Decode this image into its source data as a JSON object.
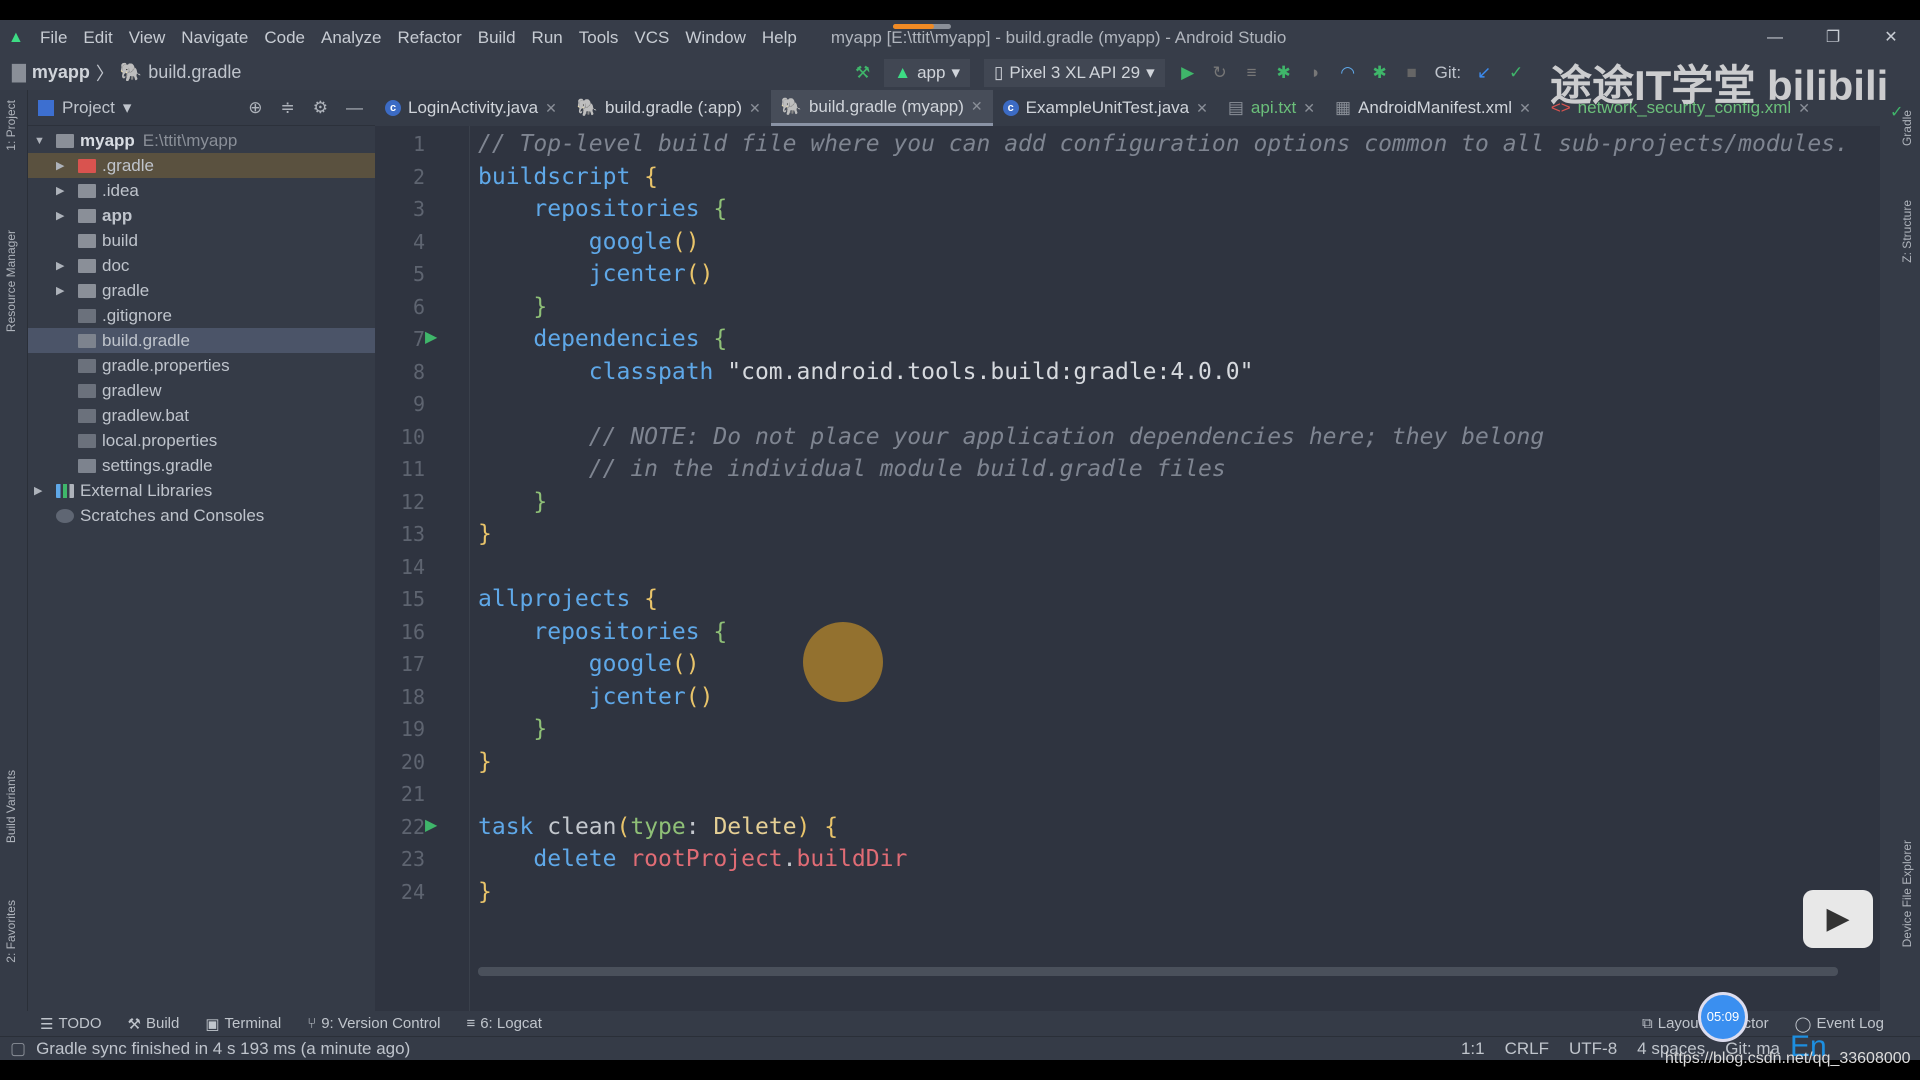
{
  "window": {
    "title": "myapp [E:\\ttit\\myapp] - build.gradle (myapp) - Android Studio",
    "load_progress": 0.7
  },
  "menu": [
    "File",
    "Edit",
    "View",
    "Navigate",
    "Code",
    "Analyze",
    "Refactor",
    "Build",
    "Run",
    "Tools",
    "VCS",
    "Window",
    "Help"
  ],
  "breadcrumb": {
    "project": "myapp",
    "file": "build.gradle"
  },
  "toolbar": {
    "config": "app",
    "device": "Pixel 3 XL API 29",
    "git_label": "Git:"
  },
  "left_strip": {
    "project": "1: Project",
    "resource": "Resource Manager",
    "variants": "Build Variants",
    "favorites": "2: Favorites"
  },
  "right_strip": {
    "gradle": "Gradle",
    "structure": "Z: Structure",
    "device": "Device File Explorer"
  },
  "project_panel": {
    "title": "Project",
    "root": {
      "name": "myapp",
      "path": "E:\\ttit\\myapp"
    },
    "items": [
      {
        "name": ".gradle",
        "type": "folder-excluded",
        "expandable": true
      },
      {
        "name": ".idea",
        "type": "folder",
        "expandable": true
      },
      {
        "name": "app",
        "type": "module",
        "expandable": true
      },
      {
        "name": "build",
        "type": "folder",
        "expandable": false
      },
      {
        "name": "doc",
        "type": "folder",
        "expandable": true
      },
      {
        "name": "gradle",
        "type": "folder",
        "expandable": true
      },
      {
        "name": ".gitignore",
        "type": "file",
        "expandable": false
      },
      {
        "name": "build.gradle",
        "type": "gradle",
        "expandable": false,
        "selected": true
      },
      {
        "name": "gradle.properties",
        "type": "properties",
        "expandable": false
      },
      {
        "name": "gradlew",
        "type": "script",
        "expandable": false
      },
      {
        "name": "gradlew.bat",
        "type": "file",
        "expandable": false
      },
      {
        "name": "local.properties",
        "type": "properties",
        "expandable": false
      },
      {
        "name": "settings.gradle",
        "type": "gradle",
        "expandable": false
      }
    ],
    "external": "External Libraries",
    "scratches": "Scratches and Consoles"
  },
  "tabs": [
    {
      "label": "LoginActivity.java",
      "icon": "C"
    },
    {
      "label": "build.gradle (:app)",
      "icon": "gradle"
    },
    {
      "label": "build.gradle (myapp)",
      "icon": "gradle",
      "active": true
    },
    {
      "label": "ExampleUnitTest.java",
      "icon": "C"
    },
    {
      "label": "api.txt",
      "icon": "text"
    },
    {
      "label": "AndroidManifest.xml",
      "icon": "MF"
    },
    {
      "label": "network_security_config.xml",
      "icon": "xml"
    }
  ],
  "code": [
    [
      [
        "// Top-level build file where you can add configuration options common to all sub-projects/modules.",
        "c"
      ]
    ],
    [
      [
        "buildscript ",
        "k"
      ],
      [
        "{",
        "b"
      ]
    ],
    [
      [
        "    repositories ",
        "k"
      ],
      [
        "{",
        "g"
      ]
    ],
    [
      [
        "        google",
        "k"
      ],
      [
        "()",
        "p"
      ]
    ],
    [
      [
        "        jcenter",
        "k"
      ],
      [
        "()",
        "p"
      ]
    ],
    [
      [
        "    }",
        "g"
      ]
    ],
    [
      [
        "    dependencies ",
        "k"
      ],
      [
        "{",
        "g"
      ]
    ],
    [
      [
        "        classpath ",
        "k"
      ],
      [
        "\"com.android.tools.build:gradle:4.0.0\"",
        "s"
      ]
    ],
    [
      [
        "",
        ""
      ]
    ],
    [
      [
        "        // NOTE: Do not place your application dependencies here; they belong",
        "c"
      ]
    ],
    [
      [
        "        // in the individual module build.gradle files",
        "c"
      ]
    ],
    [
      [
        "    }",
        "g"
      ]
    ],
    [
      [
        "}",
        "b"
      ]
    ],
    [
      [
        "",
        ""
      ]
    ],
    [
      [
        "allprojects ",
        "k"
      ],
      [
        "{",
        "b"
      ]
    ],
    [
      [
        "    repositories ",
        "k"
      ],
      [
        "{",
        "g"
      ]
    ],
    [
      [
        "        google",
        "k"
      ],
      [
        "()",
        "p"
      ]
    ],
    [
      [
        "        jcenter",
        "k"
      ],
      [
        "()",
        "p"
      ]
    ],
    [
      [
        "    }",
        "g"
      ]
    ],
    [
      [
        "}",
        "b"
      ]
    ],
    [
      [
        "",
        ""
      ]
    ],
    [
      [
        "task ",
        "k"
      ],
      [
        "clean",
        "n"
      ],
      [
        "(",
        "p"
      ],
      [
        "type",
        "g"
      ],
      [
        ": ",
        "n"
      ],
      [
        "Delete",
        "t"
      ],
      [
        ") ",
        "p"
      ],
      [
        "{",
        "b"
      ]
    ],
    [
      [
        "    delete ",
        "k"
      ],
      [
        "rootProject",
        "r"
      ],
      [
        ".",
        "n"
      ],
      [
        "buildDir",
        "r"
      ]
    ],
    [
      [
        "}",
        "b"
      ]
    ]
  ],
  "run_markers": [
    7,
    22
  ],
  "tool_windows": [
    "TODO",
    "Build",
    "Terminal",
    "9: Version Control",
    "6: Logcat",
    "Layout Inspector",
    "Event Log"
  ],
  "status": {
    "message": "Gradle sync finished in 4 s 193 ms (a minute ago)",
    "position": "1:1",
    "line_sep": "CRLF",
    "encoding": "UTF-8",
    "indent": "4 spaces",
    "git": "Git: ma"
  },
  "overlay": {
    "timer": "05:09",
    "watermark": "途途IT学堂 bilibili",
    "url": "https://blog.csdn.net/qq_33608000",
    "ime": "En"
  }
}
